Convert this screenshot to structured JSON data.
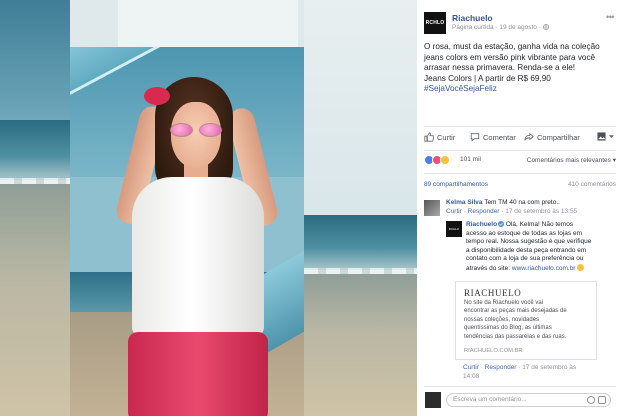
{
  "post": {
    "page_name": "Riachuelo",
    "avatar_text": "RCHLO",
    "meta": "Página curtida · 19 de agosto · ",
    "caption_lines": [
      "O rosa, must da estação, ganha vida na coleção",
      "jeans colors em versão pink vibrante para você",
      "arrasar nessa primavera. Renda-se a ele!",
      "Jeans Colors | A partir de R$ 69,90"
    ],
    "hashtag": "#SejaVocêSejaFeliz"
  },
  "actions": {
    "like": "Curtir",
    "comment": "Comentar",
    "share": "Compartilhar"
  },
  "reactions": {
    "count": "101 mil",
    "sort_label": "Comentários mais relevantes ▾",
    "shares": "89 compartilhamentos",
    "comments_count": "410 comentários"
  },
  "comments": [
    {
      "author": "Kelma Silva",
      "text": " Tem TM 40 na com preto..",
      "like": "Curtir",
      "reply": "Responder",
      "time": " · 17 de setembro às 13:55"
    },
    {
      "author": "Riachuelo",
      "text_lines": [
        " Olá, Kelma! Não temos",
        "acesso ao estoque de todas as lojas em",
        "tempo real. Nossa sugestão é que verifique",
        "a disponibilidade desta peça entrando em",
        "contato com a loja de sua preferência ou",
        "através do site: "
      ],
      "link": "www.riachuelo.com.br",
      "like": "Curtir",
      "reply": "Responder",
      "time_line1": " · 17 de setembro às",
      "time_line2": "14:08"
    }
  ],
  "link_card": {
    "brand": "RIACHUELO",
    "desc_lines": [
      "No site da Riachuelo você vai",
      "encontrar as peças mais desejadas de",
      "nossas coleções, novidades",
      "quentíssimas do Blog, as últimas",
      "tendências das passarelas e das ruas."
    ],
    "url": "RIACHUELO.COM.BR"
  },
  "composer": {
    "placeholder": "Escreva um comentário..."
  },
  "colors": {
    "link_blue": "#365899",
    "text": "#1d2129",
    "muted": "#90949c",
    "pink_pants": "#e94a6e"
  }
}
